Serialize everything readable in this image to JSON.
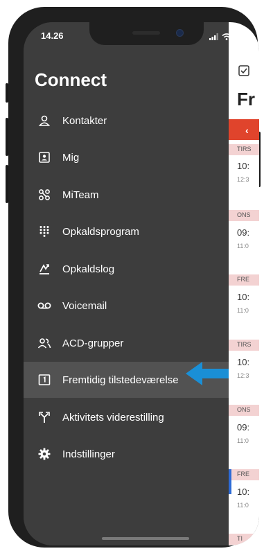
{
  "status_bar": {
    "time": "14.26",
    "icons": [
      "signal-icon",
      "wifi-icon",
      "battery-icon"
    ]
  },
  "drawer": {
    "title": "Connect",
    "items": [
      {
        "label": "Kontakter",
        "icon": "person-icon"
      },
      {
        "label": "Mig",
        "icon": "id-card-icon"
      },
      {
        "label": "MiTeam",
        "icon": "team-icon"
      },
      {
        "label": "Opkaldsprogram",
        "icon": "dialpad-icon"
      },
      {
        "label": "Opkaldslog",
        "icon": "call-log-icon"
      },
      {
        "label": "Voicemail",
        "icon": "voicemail-icon"
      },
      {
        "label": "ACD-grupper",
        "icon": "group-icon"
      },
      {
        "label": "Fremtidig tilstedeværelse",
        "icon": "calendar-one-icon",
        "active": true
      },
      {
        "label": "Aktivitets viderestilling",
        "icon": "forward-icon"
      },
      {
        "label": "Indstillinger",
        "icon": "gear-icon"
      }
    ]
  },
  "background_screen": {
    "title_fragment": "Fr",
    "days": [
      {
        "day": "TIRS",
        "time": "10:",
        "sub": "12:3"
      },
      {
        "day": "ONS",
        "time": "09:",
        "sub": "11:0"
      },
      {
        "day": "FRE",
        "time": "10:",
        "sub": "11:0"
      },
      {
        "day": "TIRS",
        "time": "10:",
        "sub": "12:3"
      },
      {
        "day": "ONS",
        "time": "09:",
        "sub": "11:0"
      },
      {
        "day": "FRE",
        "time": "10:",
        "sub": "11:0"
      },
      {
        "day": "TI",
        "time": "",
        "sub": ""
      }
    ]
  },
  "colors": {
    "drawer_bg": "#3d3d3d",
    "active_item_bg": "#525252",
    "accent_red": "#e0442c",
    "arrow_blue": "#1a8fd6",
    "day_header_pink": "#f3d2d2"
  }
}
